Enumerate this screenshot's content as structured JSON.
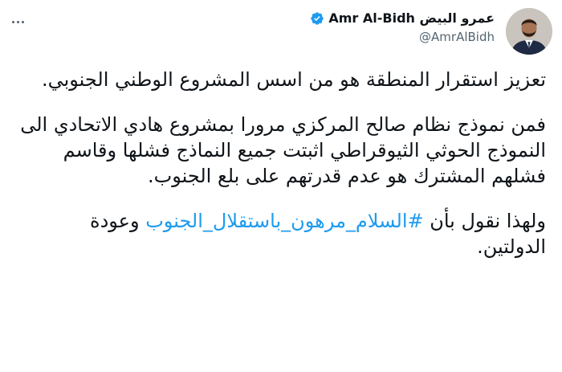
{
  "author": {
    "display_name": "Amr Al-Bidh عمرو البيض",
    "handle": "@AmrAlBidh",
    "verified": true,
    "verified_color": "#1d9bf0"
  },
  "tweet": {
    "paragraph1": "تعزيز استقرار المنطقة هو من اسس المشروع الوطني الجنوبي.",
    "paragraph2": " فمن نموذج نظام صالح المركزي مرورا بمشروع هادي الاتحادي الى النموذج الحوثي الثيوقراطي اثبتت جميع النماذج فشلها وقاسم فشلهم المشترك هو عدم قدرتهم على بلع الجنوب.",
    "paragraph3_prefix": "ولهذا نقول بأن ",
    "hashtag": "#السلام_مرهون_باستقلال_الجنوب",
    "paragraph3_suffix": " وعودة الدولتين.",
    "hashtag_color": "#1d9bf0"
  },
  "icons": {
    "more": "more-horizontal-icon",
    "verified": "verified-badge-icon"
  }
}
